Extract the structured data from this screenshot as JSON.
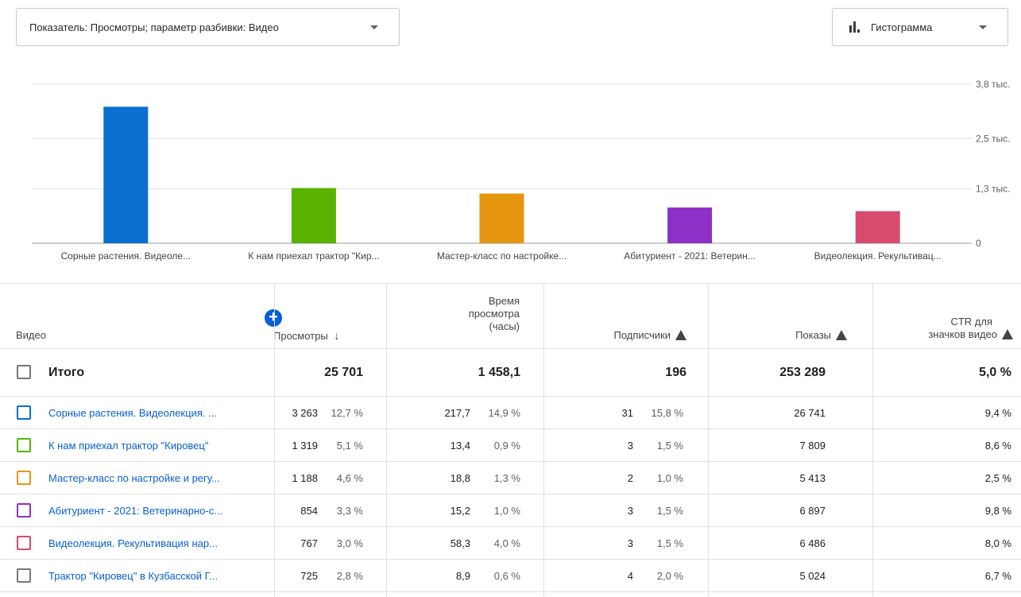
{
  "metric_dropdown": {
    "label": "Показатель: Просмотры; параметр разбивки: Видео"
  },
  "chart_type_dropdown": {
    "label": "Гистограмма"
  },
  "chart_data": {
    "type": "bar",
    "categories": [
      "Сорные растения. Видеоле...",
      "К нам приехал трактор \"Кир...",
      "Мастер-класс по настройке...",
      "Абитуриент - 2021: Ветерин...",
      "Видеолекция. Рекультивац..."
    ],
    "values": [
      3263,
      1319,
      1188,
      854,
      767
    ],
    "colors": [
      "#0b6fd0",
      "#5ab203",
      "#e69510",
      "#8d30c6",
      "#d74b6d"
    ],
    "ylim": [
      0,
      3800
    ],
    "yticks": [
      0,
      1300,
      2500,
      3800
    ],
    "ytick_labels": [
      "0",
      "1,3 тыс.",
      "2,5 тыс.",
      "3,8 тыс."
    ],
    "grid": true
  },
  "table": {
    "headers": {
      "video": "Видео",
      "views": "Просмотры",
      "watch_time_1": "Время",
      "watch_time_2": "просмотра",
      "watch_time_3": "(часы)",
      "subscribers": "Подписчики",
      "impressions": "Показы",
      "ctr_1": "CTR для",
      "ctr_2": "значков видео"
    },
    "total": {
      "label": "Итого",
      "views": "25 701",
      "watch": "1 458,1",
      "subs": "196",
      "impr": "253 289",
      "ctr": "5,0 %"
    },
    "rows": [
      {
        "title": "Сорные растения. Видеолекция. ...",
        "color": "#0b6fd0",
        "views": "3 263",
        "views_pct": "12,7 %",
        "watch": "217,7",
        "watch_pct": "14,9 %",
        "subs": "31",
        "subs_pct": "15,8 %",
        "impr": "26 741",
        "ctr": "9,4 %"
      },
      {
        "title": "К нам приехал трактор \"Кировец\"",
        "color": "#5ab203",
        "views": "1 319",
        "views_pct": "5,1 %",
        "watch": "13,4",
        "watch_pct": "0,9 %",
        "subs": "3",
        "subs_pct": "1,5 %",
        "impr": "7 809",
        "ctr": "8,6 %"
      },
      {
        "title": "Мастер-класс по настройке и регу...",
        "color": "#e69510",
        "views": "1 188",
        "views_pct": "4,6 %",
        "watch": "18,8",
        "watch_pct": "1,3 %",
        "subs": "2",
        "subs_pct": "1,0 %",
        "impr": "5 413",
        "ctr": "2,5 %"
      },
      {
        "title": "Абитуриент - 2021: Ветеринарно-с...",
        "color": "#8d30c6",
        "views": "854",
        "views_pct": "3,3 %",
        "watch": "15,2",
        "watch_pct": "1,0 %",
        "subs": "3",
        "subs_pct": "1,5 %",
        "impr": "6 897",
        "ctr": "9,8 %"
      },
      {
        "title": "Видеолекция. Рекультивация нар...",
        "color": "#d74b6d",
        "views": "767",
        "views_pct": "3,0 %",
        "watch": "58,3",
        "watch_pct": "4,0 %",
        "subs": "3",
        "subs_pct": "1,5 %",
        "impr": "6 486",
        "ctr": "8,0 %"
      },
      {
        "title": "Трактор \"Кировец\" в Кузбасской Г...",
        "color": "#777777",
        "views": "725",
        "views_pct": "2,8 %",
        "watch": "8,9",
        "watch_pct": "0,6 %",
        "subs": "4",
        "subs_pct": "2,0 %",
        "impr": "5 024",
        "ctr": "6,7 %"
      }
    ]
  }
}
